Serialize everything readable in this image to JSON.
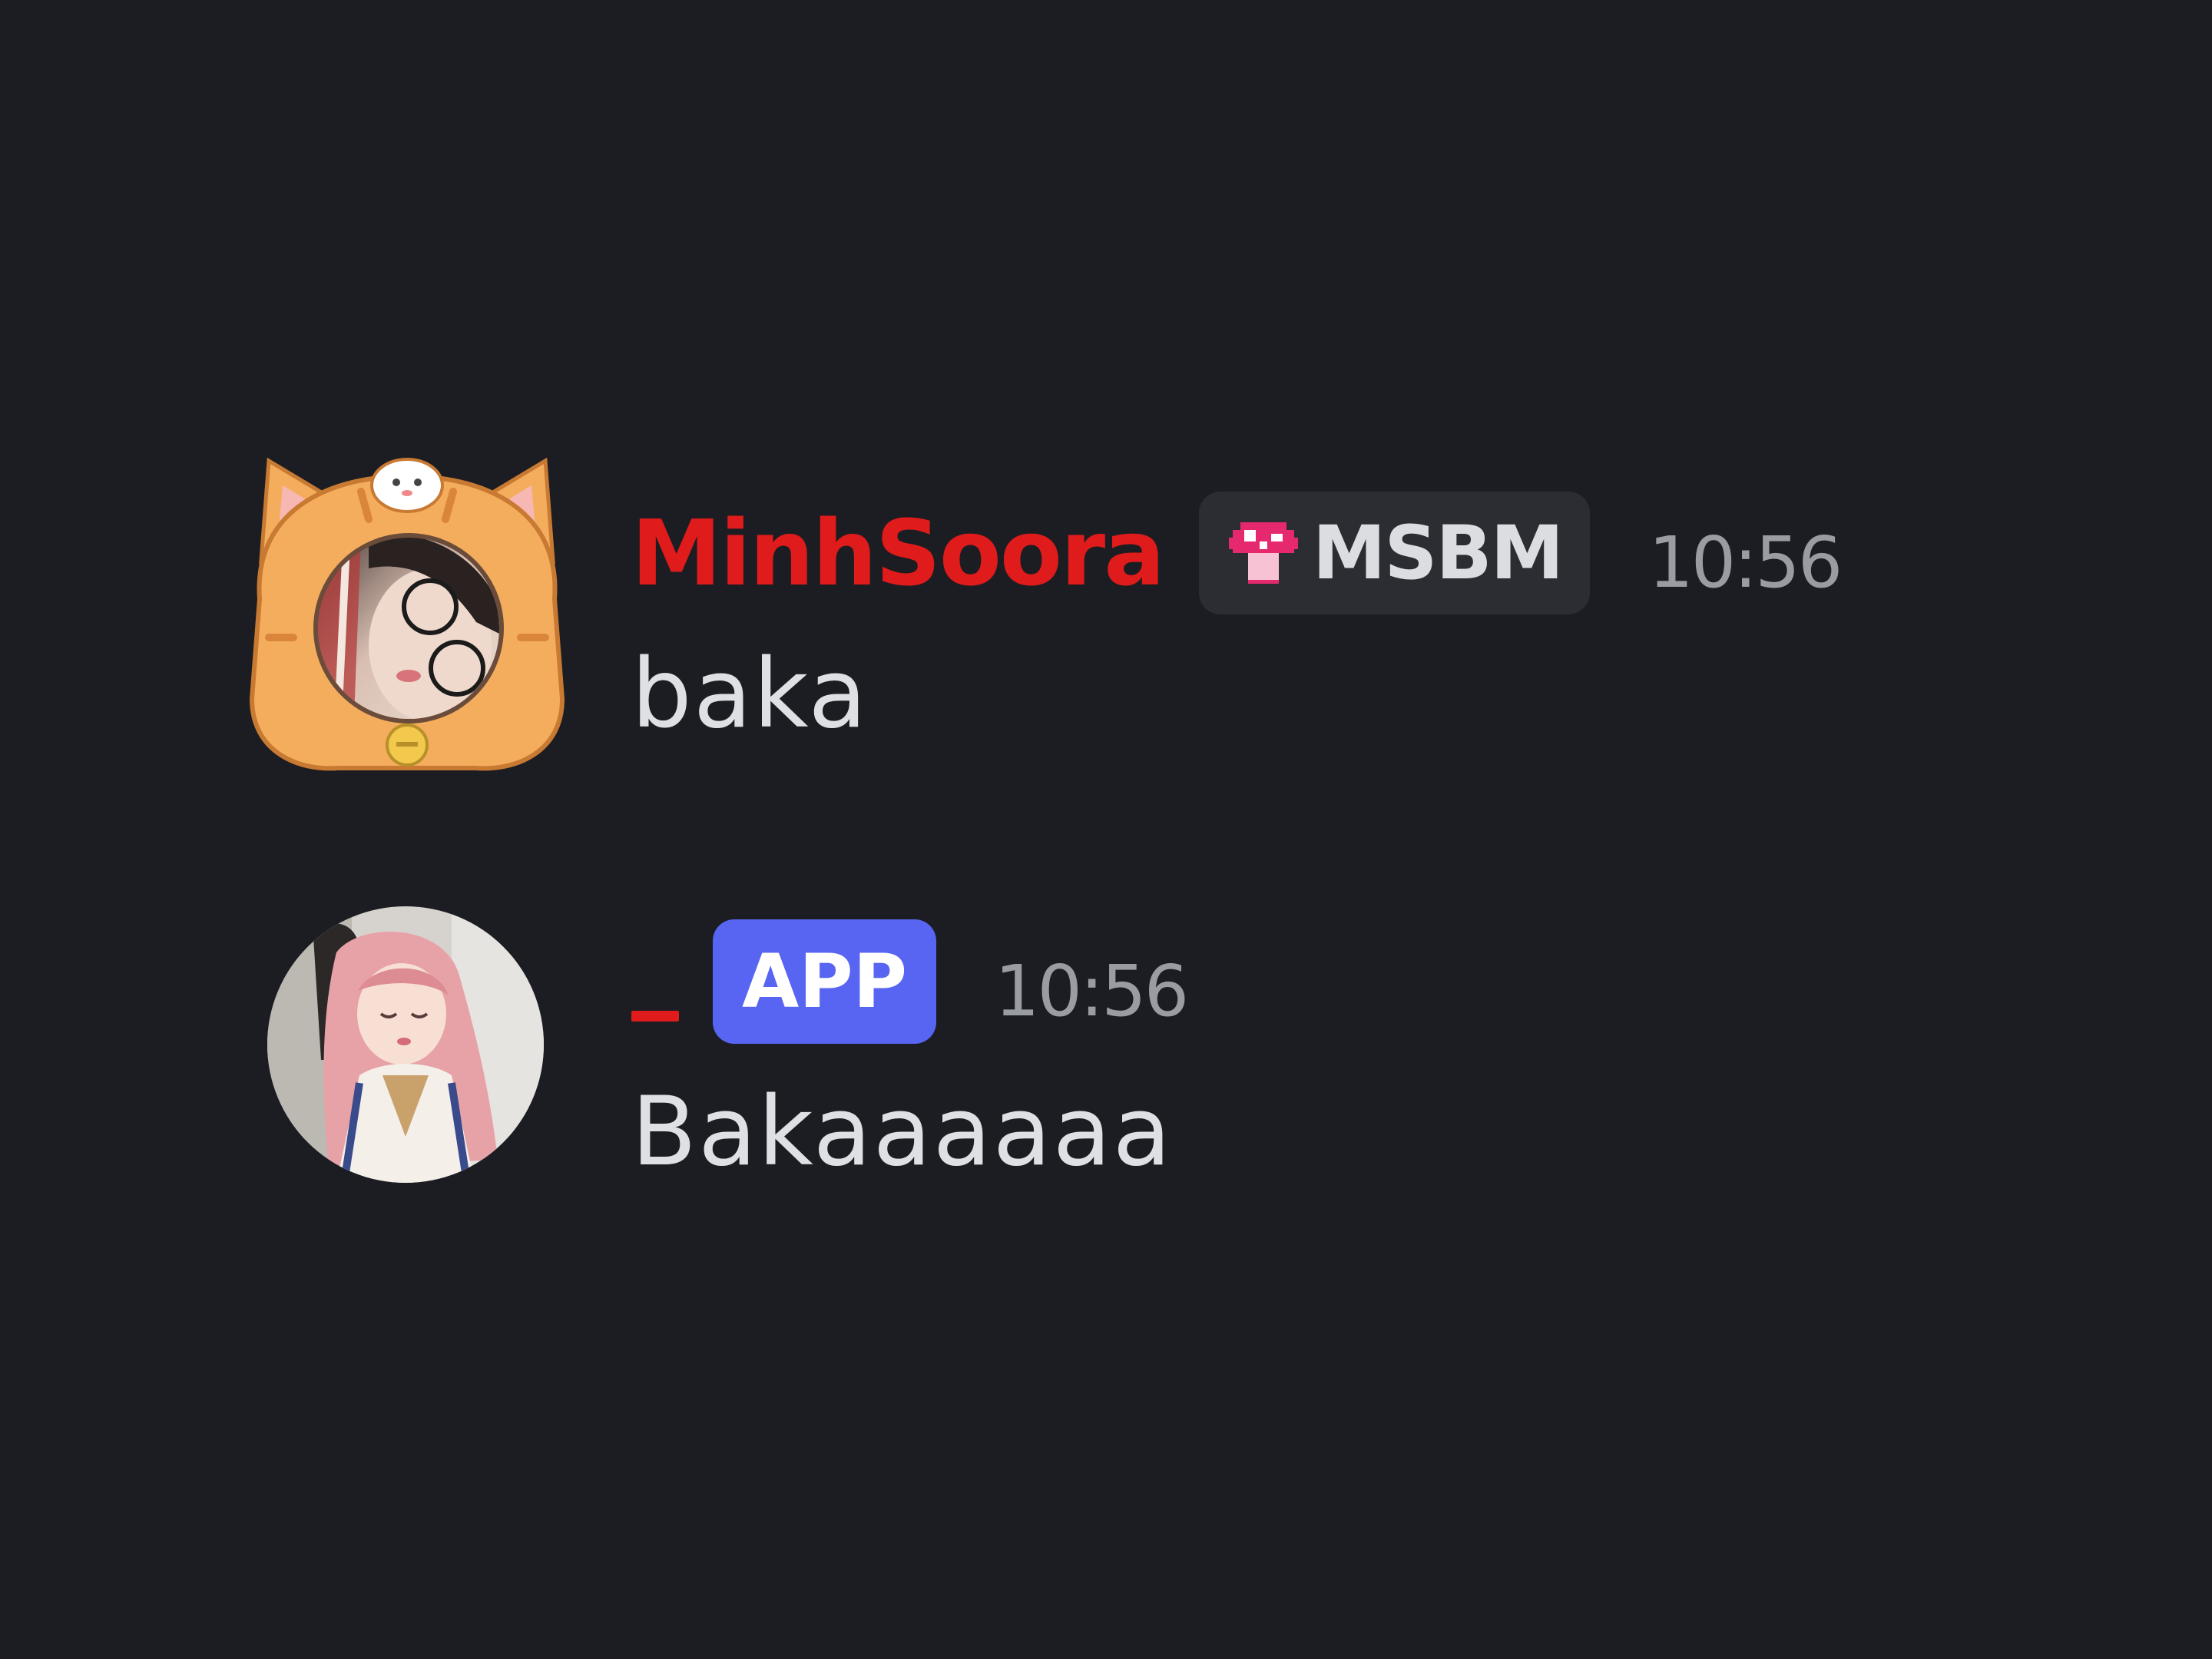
{
  "messages": [
    {
      "username": "MinhSoora",
      "tag": {
        "icon": "mushroom-icon",
        "label": "MSBM"
      },
      "time": "10:56",
      "text": "baka",
      "name_color": "#e01b1b",
      "avatar_decoration": "cat-hood-frame"
    },
    {
      "username": "_",
      "badge": "APP",
      "time": "10:56",
      "text": "Bakaaaaaa",
      "name_color": "#e01b1b",
      "badge_color": "#5865f2"
    }
  ],
  "theme": {
    "background": "#1c1d22",
    "tag_background": "#2b2d33",
    "text": "#dfe0e4",
    "timestamp": "#9a9ca4"
  }
}
